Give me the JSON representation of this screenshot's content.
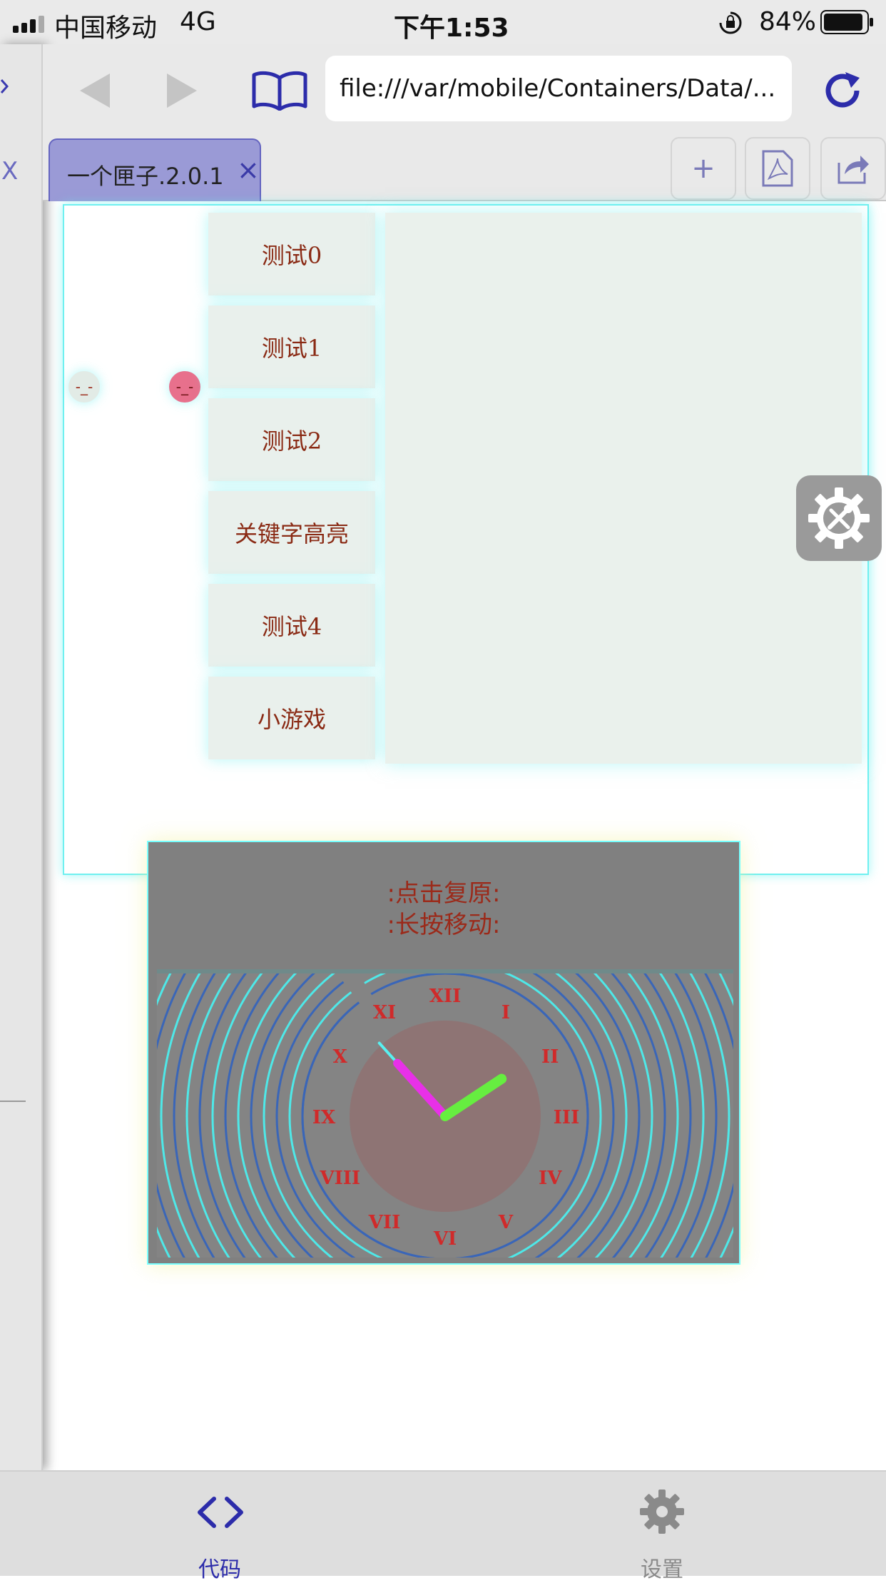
{
  "status_bar": {
    "carrier": "中国移动",
    "network": "4G",
    "time": "下午1:53",
    "battery": "84%"
  },
  "browser": {
    "url": "file:///var/mobile/Containers/Data/...",
    "left_tab_close": "X",
    "tab": {
      "title": "一个匣子.2.0.1",
      "close": "×"
    },
    "new_tab": "+"
  },
  "app": {
    "menu": [
      "测试0",
      "测试1",
      "测试2",
      "关键字高亮",
      "测试4",
      "小游戏"
    ],
    "faces": [
      "-_-",
      "-_-"
    ],
    "widget": {
      "line1": ":点击复原:",
      "line2": ":长按移动:"
    },
    "clock": {
      "numerals": [
        "XII",
        "I",
        "II",
        "III",
        "IV",
        "V",
        "VI",
        "VII",
        "VIII",
        "IX",
        "X",
        "XI"
      ],
      "time": "1:53"
    }
  },
  "bottom_tabs": [
    {
      "label": "代码",
      "icon": "code-icon",
      "color": "#2c2caa"
    },
    {
      "label": "设置",
      "icon": "gear-icon",
      "color": "#8a8a8a"
    }
  ]
}
